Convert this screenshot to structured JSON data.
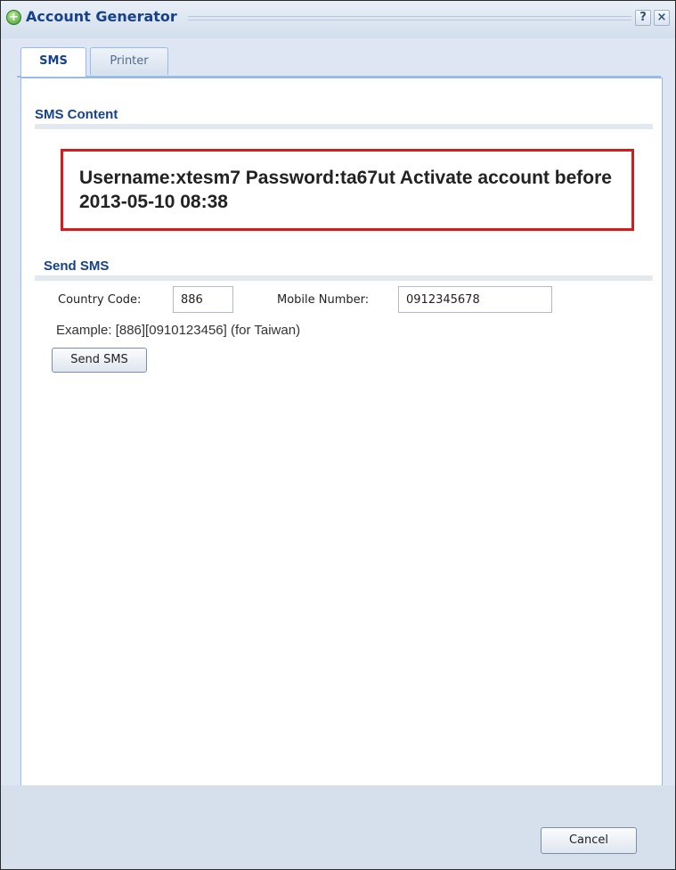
{
  "window": {
    "title": "Account Generator",
    "help_glyph": "?",
    "close_glyph": "×"
  },
  "tabs": [
    {
      "label": "SMS",
      "active": true
    },
    {
      "label": "Printer",
      "active": false
    }
  ],
  "sms_content": {
    "header": "SMS Content",
    "message": "Username:xtesm7 Password:ta67ut Activate account before 2013-05-10 08:38",
    "highlight_color": "#d71a1a"
  },
  "send_sms": {
    "header": "Send SMS",
    "country_code_label": "Country Code:",
    "country_code_value": "886",
    "mobile_number_label": "Mobile Number:",
    "mobile_number_value": "0912345678",
    "example": "Example: [886][0910123456] (for Taiwan)",
    "button_label": "Send SMS"
  },
  "footer": {
    "cancel_label": "Cancel"
  },
  "colors": {
    "accent": "#15428b",
    "border": "#99bbe8"
  },
  "icons": {
    "title": "add-circle-icon",
    "help": "help-icon",
    "close": "close-icon"
  }
}
